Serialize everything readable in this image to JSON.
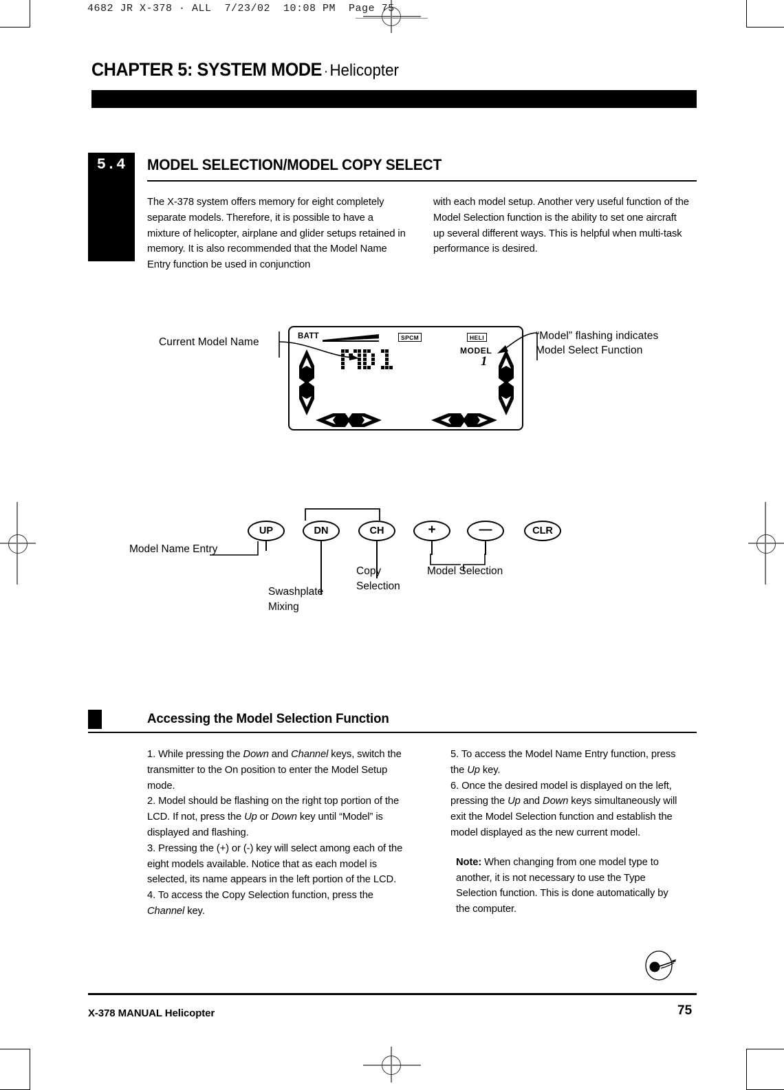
{
  "slug": {
    "text": "4682 JR X-378 · ALL  7/23/02  10:08 PM  Page 75"
  },
  "header": {
    "chapter": "CHAPTER 5: SYSTEM MODE",
    "separator": "·",
    "subject": "Helicopter"
  },
  "section": {
    "number": "5.4",
    "title": "MODEL SELECTION/MODEL COPY SELECT",
    "intro_left": "The X-378 system offers memory for eight completely separate models. Therefore, it is possible to have a mixture of helicopter, airplane and glider setups retained in memory. It is also recommended that the Model Name Entry function be used in conjunction",
    "intro_right": "with each model setup. Another very useful function of the Model Selection function is the ability to set one aircraft up several different ways. This is helpful when multi-task performance is desired."
  },
  "lcd": {
    "batt_label": "BATT",
    "spcm_label": "SPCM",
    "heli_label": "HELI",
    "model_word": "MODEL",
    "model_number": "1",
    "model_name": "MD1",
    "callout_left": "Current Model Name",
    "callout_right_line1": "“Model” flashing indicates",
    "callout_right_line2": "Model Select Function"
  },
  "keys": {
    "buttons": [
      {
        "label": "UP",
        "name": "key-up"
      },
      {
        "label": "DN",
        "name": "key-dn"
      },
      {
        "label": "CH",
        "name": "key-ch"
      },
      {
        "label": "+",
        "name": "key-plus"
      },
      {
        "label": "—",
        "name": "key-minus"
      },
      {
        "label": "CLR",
        "name": "key-clr"
      }
    ],
    "label_model_name_entry": "Model Name Entry",
    "label_swashplate_line1": "Swashplate",
    "label_swashplate_line2": "Mixing",
    "label_copy_line1": "Copy",
    "label_copy_line2": "Selection",
    "label_model_selection": "Model Selection"
  },
  "procedure": {
    "heading": "Accessing the Model Selection Function",
    "left_steps": [
      "1. While pressing the <i>Down</i> and <i>Channel</i> keys, switch the transmitter to the On position to enter the Model Setup mode.",
      "2. Model should be flashing on the right top portion of the LCD. If not, press the <i>Up</i> or <i>Down</i> key until “Model” is displayed and flashing.",
      "3. Pressing the (+) or (-) key will select among each of the eight models available. Notice that as each model is selected, its name appears in the left portion of the LCD.",
      "4. To access the Copy Selection function, press the <i>Channel</i> key."
    ],
    "right_steps": [
      "5. To access the Model Name Entry function, press the <i>Up</i> key.",
      "6. Once the desired model is displayed on the left, pressing the <i>Up</i> and <i>Down</i> keys simultaneously will exit the Model Selection function and establish the model displayed as the new current model."
    ],
    "note_label": "Note:",
    "note_text": " When changing from one model type to another, it is not necessary to use the Type Selection function. This is done automatically by the computer."
  },
  "footer": {
    "left": "X-378 MANUAL  Helicopter",
    "page": "75"
  }
}
